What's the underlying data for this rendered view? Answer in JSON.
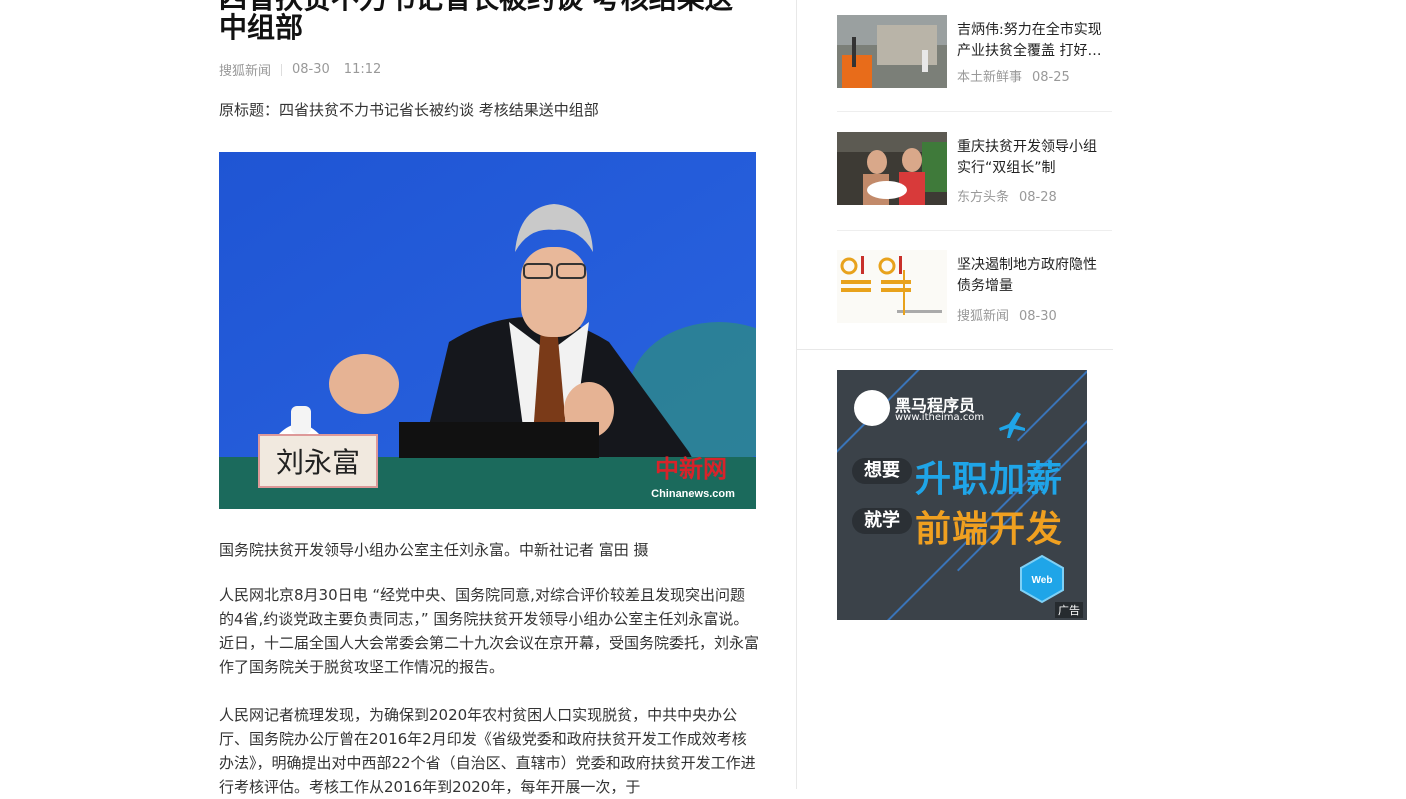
{
  "article": {
    "title_partial": "四省扶贫不力书记省长被约谈 考核结果送",
    "title_line2": "中组部",
    "source": "搜狐新闻",
    "date": "08-30",
    "time": "11:12",
    "original_title": "原标题：四省扶贫不力书记省长被约谈 考核结果送中组部",
    "photo": {
      "nameplate": "刘永富",
      "watermark": "中新网",
      "watermark_sub": "Chinanews.com"
    },
    "caption": "国务院扶贫开发领导小组办公室主任刘永富。中新社记者 富田 摄",
    "paragraphs": [
      "人民网北京8月30日电 “经党中央、国务院同意,对综合评价较差且发现突出问题的4省,约谈党政主要负责同志，” 国务院扶贫开发领导小组办公室主任刘永富说。近日，十二届全国人大会常委会第二十九次会议在京开幕，受国务院委托，刘永富作了国务院关于脱贫攻坚工作情况的报告。",
      "人民网记者梳理发现，为确保到2020年农村贫困人口实现脱贫，中共中央办公厅、国务院办公厅曾在2016年2月印发《省级党委和政府扶贫开发工作成效考核办法》，明确提出对中西部22个省（自治区、直辖市）党委和政府扶贫开发工作进行考核评估。考核工作从2016年到2020年，每年开展一次，于"
    ]
  },
  "sidebar": {
    "news": [
      {
        "title": "吉炳伟:努力在全市实现产业扶贫全覆盖 打好…",
        "source": "本土新鲜事",
        "date": "08-25"
      },
      {
        "title": "重庆扶贫开发领导小组实行“双组长”制",
        "source": "东方头条",
        "date": "08-28"
      },
      {
        "title": "坚决遏制地方政府隐性债务增量",
        "source": "搜狐新闻",
        "date": "08-30"
      }
    ],
    "ad": {
      "brand": "黑马程序员",
      "url": "www.itheima.com",
      "want": "想要",
      "headline1": "升职加薪",
      "learn": "就学",
      "headline2": "前端开发",
      "badge": "Web",
      "tag": "广告"
    }
  }
}
